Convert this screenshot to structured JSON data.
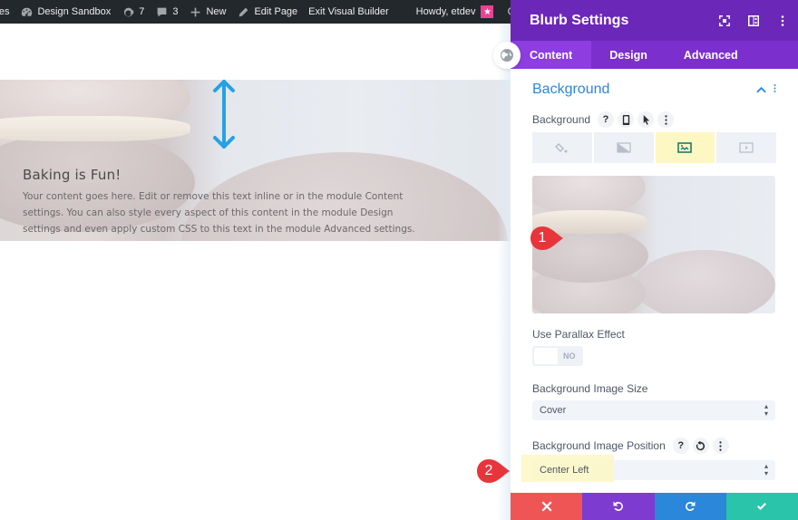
{
  "adminbar": {
    "items": [
      {
        "icon": "sites-icon",
        "label": "Sites"
      },
      {
        "icon": "dashboard-icon",
        "label": "Design Sandbox"
      },
      {
        "icon": "updates-icon",
        "label": "7"
      },
      {
        "icon": "comments-icon",
        "label": "3"
      },
      {
        "icon": "plus-icon",
        "label": "New"
      },
      {
        "icon": "pencil-icon",
        "label": "Edit Page"
      },
      {
        "icon": null,
        "label": "Exit Visual Builder"
      }
    ],
    "greeting": "Howdy, etdev",
    "search_icon": "search-icon"
  },
  "canvas": {
    "blurb": {
      "title": "Baking is Fun!",
      "body": "Your content goes here. Edit or remove this text inline or in the module Content settings. You can also style every aspect of this content in the module Design settings and even apply custom CSS to this text in the module Advanced settings."
    }
  },
  "panel": {
    "title": "Blurb Settings",
    "header_icons": [
      "expand-icon",
      "split-view-icon",
      "more-vert-icon"
    ],
    "tabs": [
      {
        "label": "Content",
        "active": true
      },
      {
        "label": "Design",
        "active": false
      },
      {
        "label": "Advanced",
        "active": false
      }
    ],
    "section": {
      "title": "Background",
      "background_label": "Background",
      "background_types": [
        {
          "name": "color-fill-icon",
          "active": false
        },
        {
          "name": "gradient-icon",
          "active": false
        },
        {
          "name": "image-icon",
          "active": true
        },
        {
          "name": "video-icon",
          "active": false
        }
      ],
      "parallax": {
        "label": "Use Parallax Effect",
        "value": "NO"
      },
      "image_size": {
        "label": "Background Image Size",
        "value": "Cover"
      },
      "image_position": {
        "label": "Background Image Position",
        "value": "Center Left"
      }
    },
    "footer": [
      "discard",
      "undo",
      "redo",
      "save"
    ]
  },
  "annotations": [
    {
      "number": "1"
    },
    {
      "number": "2"
    }
  ],
  "colors": {
    "panel_header": "#6b27b8",
    "tabs_bar": "#7b2fcc",
    "active_tab": "#8d3de0",
    "section_title": "#2b87da",
    "highlight": "#fdf7c4",
    "discard": "#ef5555",
    "undo": "#7e3bd0",
    "redo": "#2b87da",
    "save": "#29c4a9",
    "marker": "#e8353b",
    "arrow": "#26a1e6"
  }
}
